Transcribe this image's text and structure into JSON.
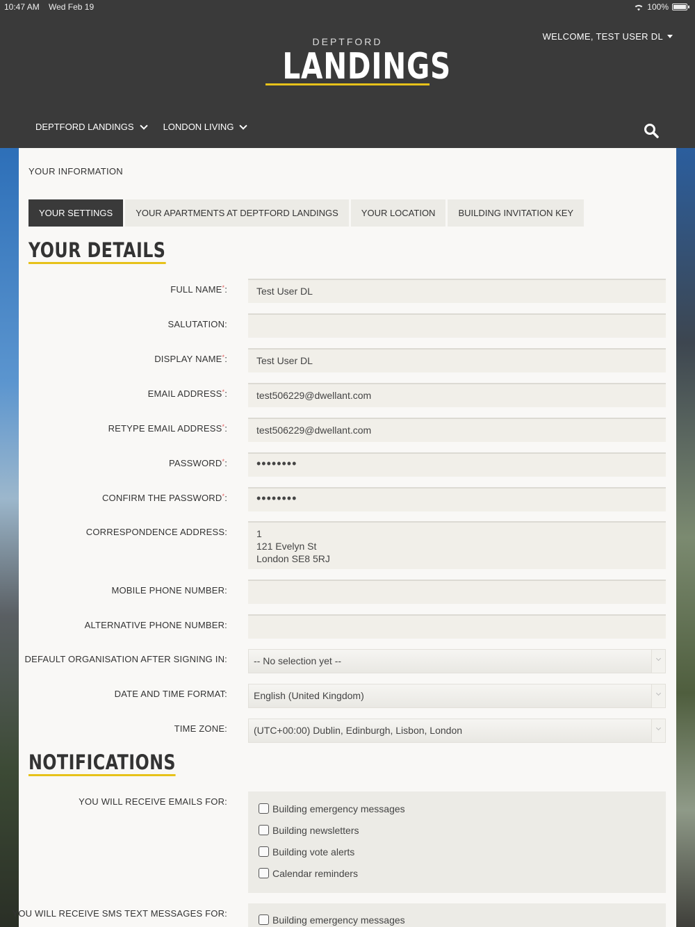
{
  "status_bar": {
    "time": "10:47 AM",
    "date": "Wed Feb 19",
    "battery": "100%"
  },
  "header": {
    "welcome": "WELCOME, TEST USER DL",
    "logo_top": "DEPTFORD",
    "logo_main": "LANDINGS",
    "nav": [
      "DEPTFORD LANDINGS",
      "LONDON LIVING"
    ]
  },
  "page": {
    "section_label": "YOUR INFORMATION",
    "tabs": [
      "YOUR SETTINGS",
      "YOUR APARTMENTS AT DEPTFORD LANDINGS",
      "YOUR LOCATION",
      "BUILDING INVITATION KEY"
    ],
    "details_heading": "YOUR DETAILS",
    "notifications_heading": "NOTIFICATIONS"
  },
  "form": {
    "full_name": {
      "label": "FULL NAME",
      "value": "Test User DL"
    },
    "salutation": {
      "label": "SALUTATION:",
      "value": ""
    },
    "display_name": {
      "label": "DISPLAY NAME",
      "value": "Test User DL"
    },
    "email": {
      "label": "EMAIL ADDRESS",
      "value": "test506229@dwellant.com"
    },
    "retype_email": {
      "label": "RETYPE EMAIL ADDRESS",
      "value": "test506229@dwellant.com"
    },
    "password": {
      "label": "PASSWORD",
      "value": "••••••••"
    },
    "confirm_password": {
      "label": "CONFIRM THE PASSWORD",
      "value": "••••••••"
    },
    "address": {
      "label": "CORRESPONDENCE ADDRESS:",
      "line1": "1",
      "line2": "121 Evelyn St",
      "line3": "London SE8 5RJ"
    },
    "mobile": {
      "label": "MOBILE PHONE NUMBER:",
      "value": ""
    },
    "alt_phone": {
      "label": "ALTERNATIVE PHONE NUMBER:",
      "value": ""
    },
    "default_org": {
      "label": "DEFAULT ORGANISATION AFTER SIGNING IN:",
      "value": "-- No selection yet --"
    },
    "date_format": {
      "label": "DATE AND TIME FORMAT:",
      "value": "English (United Kingdom)"
    },
    "time_zone": {
      "label": "TIME ZONE:",
      "value": "(UTC+00:00) Dublin, Edinburgh, Lisbon, London"
    },
    "required_marker": "*",
    "colon": ":"
  },
  "notifications": {
    "emails_label": "YOU WILL RECEIVE EMAILS FOR:",
    "email_options": [
      "Building emergency messages",
      "Building newsletters",
      "Building vote alerts",
      "Calendar reminders"
    ],
    "sms_label": "YOU WILL RECEIVE SMS TEXT MESSAGES FOR:",
    "sms_options": [
      "Building emergency messages"
    ]
  },
  "colors": {
    "accent": "#e7c21a",
    "header_bg": "#3a3a3a",
    "required": "#e05a5a"
  }
}
